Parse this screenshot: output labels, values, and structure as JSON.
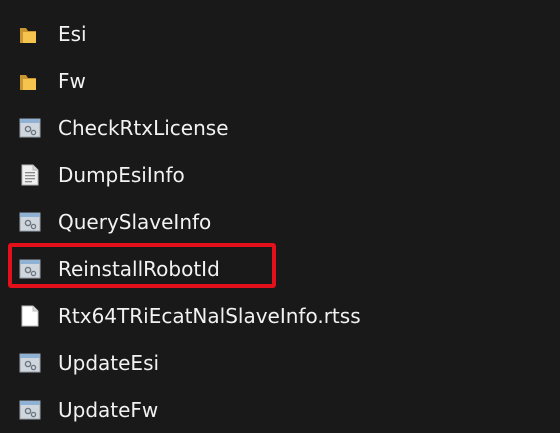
{
  "colors": {
    "background": "#191919",
    "text": "#f2f2f2",
    "folder": "#f4c44e",
    "highlight": "#e3101b"
  },
  "items": [
    {
      "label": "Esi",
      "icon": "folder-icon"
    },
    {
      "label": "Fw",
      "icon": "folder-icon"
    },
    {
      "label": "CheckRtxLicense",
      "icon": "application-icon"
    },
    {
      "label": "DumpEsiInfo",
      "icon": "text-document-icon"
    },
    {
      "label": "QuerySlaveInfo",
      "icon": "application-icon"
    },
    {
      "label": "ReinstallRobotId",
      "icon": "application-icon",
      "highlighted": true
    },
    {
      "label": "Rtx64TRiEcatNalSlaveInfo.rtss",
      "icon": "file-icon"
    },
    {
      "label": "UpdateEsi",
      "icon": "application-icon"
    },
    {
      "label": "UpdateFw",
      "icon": "application-icon"
    }
  ]
}
